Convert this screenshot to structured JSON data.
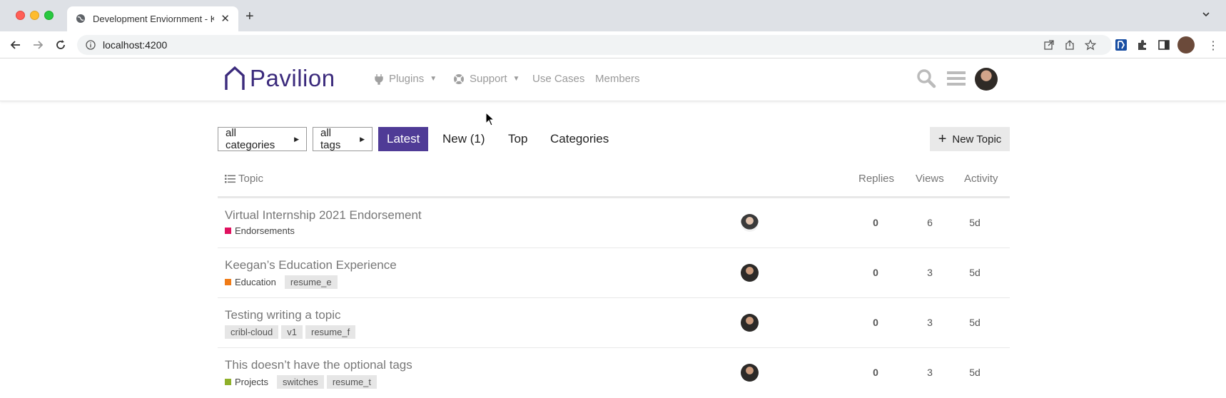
{
  "browser": {
    "tab_title": "Development Enviornment - Ke",
    "url": "localhost:4200"
  },
  "site": {
    "brand": "Pavilion",
    "nav": [
      {
        "label": "Plugins",
        "icon": "plug-icon",
        "dropdown": true
      },
      {
        "label": "Support",
        "icon": "lifebuoy-icon",
        "dropdown": true
      },
      {
        "label": "Use Cases"
      },
      {
        "label": "Members"
      }
    ],
    "brand_color": "#3b2a7c"
  },
  "filters": {
    "categories": "all categories",
    "tags": "all tags",
    "tabs": [
      "Latest",
      "New (1)",
      "Top",
      "Categories"
    ],
    "active_tab": "Latest",
    "new_topic": "New Topic",
    "active_color": "#4f3b96"
  },
  "list": {
    "columns": {
      "topic": "Topic",
      "replies": "Replies",
      "views": "Views",
      "activity": "Activity"
    },
    "rows": [
      {
        "title": "Virtual Internship 2021 Endorsement",
        "category": "Endorsements",
        "category_color": "#e0115f",
        "tags": [],
        "replies": "0",
        "views": "6",
        "activity": "5d"
      },
      {
        "title": "Keegan’s Education Experience",
        "category": "Education",
        "category_color": "#f07b16",
        "tags": [
          "resume_e"
        ],
        "replies": "0",
        "views": "3",
        "activity": "5d"
      },
      {
        "title": "Testing writing a topic",
        "category": "",
        "category_color": "",
        "tags": [
          "cribl-cloud",
          "v1",
          "resume_f"
        ],
        "replies": "0",
        "views": "3",
        "activity": "5d"
      },
      {
        "title": "This doesn’t have the optional tags",
        "category": "Projects",
        "category_color": "#8fb02a",
        "tags": [
          "switches",
          "resume_t"
        ],
        "replies": "0",
        "views": "3",
        "activity": "5d"
      }
    ]
  }
}
